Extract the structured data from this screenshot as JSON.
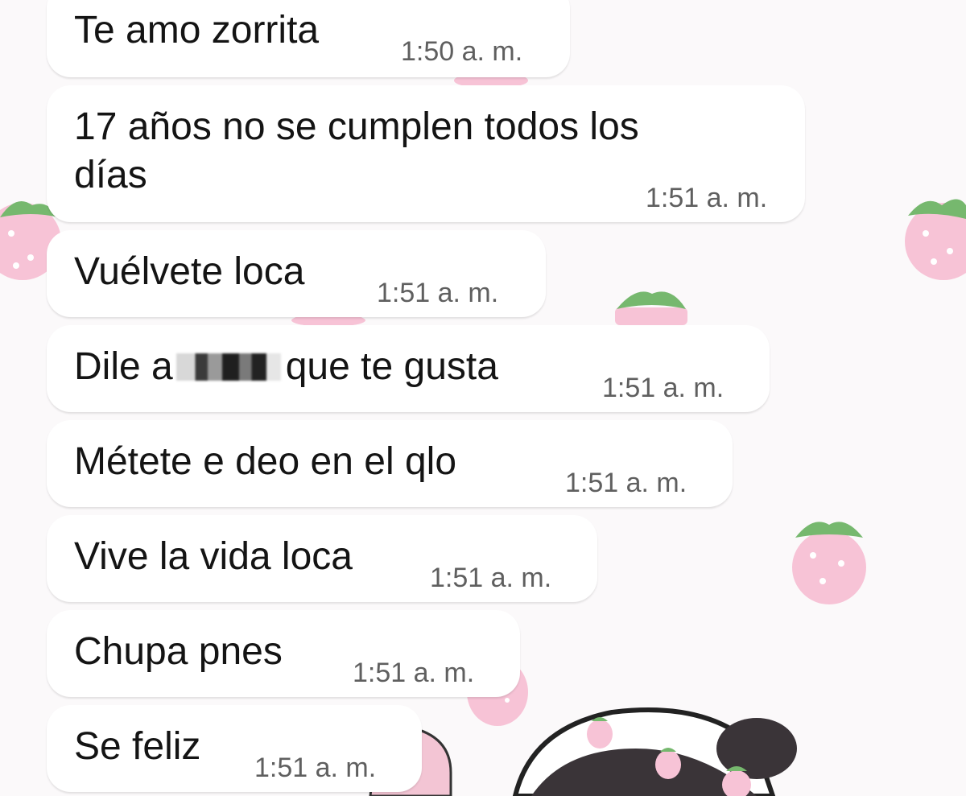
{
  "chat": {
    "messages": [
      {
        "text": "Te amo zorrita",
        "time": "1:50 a. m."
      },
      {
        "line1": "17 años no se cumplen todos los",
        "line2": "días",
        "time": "1:51 a. m."
      },
      {
        "text": "Vuélvete loca",
        "time": "1:51 a. m."
      },
      {
        "text_before": "Dile a",
        "text_after": "que te gusta",
        "time": "1:51 a. m."
      },
      {
        "text": "Métete e deo en el qlo",
        "time": "1:51 a. m."
      },
      {
        "text": "Vive la vida loca",
        "time": "1:51 a. m."
      },
      {
        "text": "Chupa pnes",
        "time": "1:51 a. m."
      },
      {
        "text": "Se feliz",
        "time": "1:51 a. m."
      }
    ]
  },
  "colors": {
    "background": "#fbf9fa",
    "bubble": "#ffffff",
    "strawberry": "#f7c3d6",
    "leaf": "#76b86e"
  },
  "wallpaper": {
    "icons": [
      "strawberry-icon",
      "cartoon-character-with-strawberry-hat"
    ]
  }
}
